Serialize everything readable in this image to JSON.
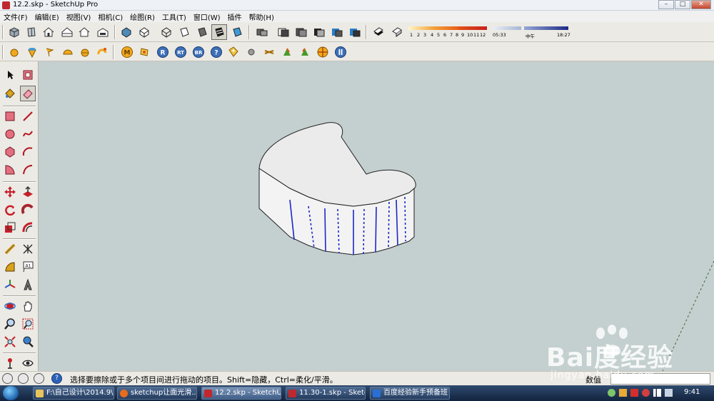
{
  "window": {
    "title": "12.2.skp - SketchUp Pro",
    "controls": [
      "–",
      "□",
      "✕"
    ]
  },
  "menubar": {
    "items": [
      "文件(F)",
      "编辑(E)",
      "视图(V)",
      "相机(C)",
      "绘图(R)",
      "工具(T)",
      "窗口(W)",
      "插件",
      "帮助(H)"
    ]
  },
  "shadow_settings": {
    "month_ticks": [
      "1",
      "2",
      "3",
      "4",
      "5",
      "6",
      "7",
      "8",
      "9",
      "10",
      "11",
      "12"
    ],
    "time_start": "05:33",
    "time_mid": "中午",
    "time_end": "18:27"
  },
  "toolbar2_labels": {
    "m": "M",
    "r": "R",
    "rt": "RT",
    "br": "BR",
    "help": "?"
  },
  "lefttoolbar": {
    "text_tool_label": "A1"
  },
  "statusbar": {
    "hint": "选择要擦除或于多个项目间进行拖动的项目。Shift=隐藏，Ctrl=柔化/平滑。",
    "measurements_label": "数值",
    "measurements_value": "",
    "icon_question": "?"
  },
  "taskbar": {
    "tasks": [
      {
        "label": "F:\\自己设计\\2014.9\\...",
        "color": "#e8c45a"
      },
      {
        "label": "sketchup让面光滑...",
        "color": "#e86c1c"
      },
      {
        "label": "12.2.skp - SketchU...",
        "color": "#c0282d"
      },
      {
        "label": "11.30-1.skp - Sketc...",
        "color": "#c0282d"
      },
      {
        "label": "百度经验新手预备班",
        "color": "#2a6fd6"
      }
    ],
    "clock": "9:41"
  },
  "watermark": {
    "brand": "Bai度经验",
    "url": "jingyan.baidu.com"
  },
  "colors": {
    "viewport_bg": "#c4cfcf",
    "soft_edge_blue": "#1d27c9",
    "model_top": "#ebebeb",
    "model_side": "#f4f4f4"
  }
}
